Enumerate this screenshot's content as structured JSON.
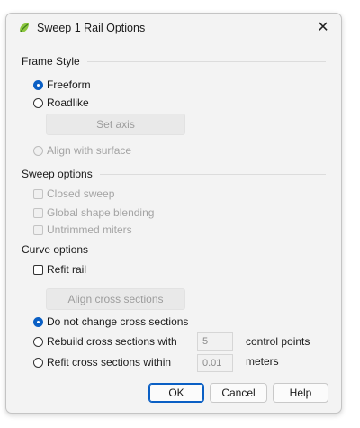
{
  "window": {
    "title": "Sweep 1 Rail Options",
    "icon": "rhino-icon",
    "close_glyph": "✕"
  },
  "frame_style": {
    "heading": "Frame Style",
    "freeform": "Freeform",
    "freeform_selected": true,
    "roadlike": "Roadlike",
    "set_axis": "Set axis",
    "align_with_surface": "Align with surface"
  },
  "sweep_options": {
    "heading": "Sweep options",
    "closed_sweep": "Closed sweep",
    "global_shape_blending": "Global shape blending",
    "untrimmed_miters": "Untrimmed miters"
  },
  "curve_options": {
    "heading": "Curve options",
    "refit_rail": "Refit rail",
    "align_cross_sections": "Align cross sections",
    "do_not_change": "Do not change cross sections",
    "do_not_change_selected": true,
    "rebuild": "Rebuild cross sections with",
    "rebuild_value": "5",
    "rebuild_unit": "control points",
    "refit": "Refit cross sections within",
    "refit_value": "0.01",
    "refit_unit": "meters"
  },
  "buttons": {
    "ok": "OK",
    "cancel": "Cancel",
    "help": "Help"
  },
  "colors": {
    "accent": "#0a5fc4",
    "dialog_bg": "#f3f3f3"
  }
}
